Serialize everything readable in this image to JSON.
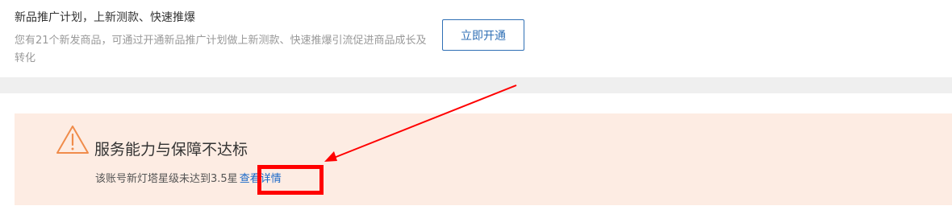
{
  "promo": {
    "title": "新品推广计划，上新测款、快速推爆",
    "description": "您有21个新发商品，可通过开通新品推广计划做上新测款、快速推爆引流促进商品成长及转化",
    "button_label": "立即开通"
  },
  "warning": {
    "title": "服务能力与保障不达标",
    "message": "该账号新灯塔星级未达到3.5星",
    "link_label": "查看详情"
  },
  "colors": {
    "accent": "#2f6fb5",
    "link": "#1a68c8",
    "warning_bg": "#fdece3",
    "warning_icon": "#f08c4b",
    "annotation": "#ff0000"
  },
  "icons": [
    "warning-triangle-icon"
  ]
}
